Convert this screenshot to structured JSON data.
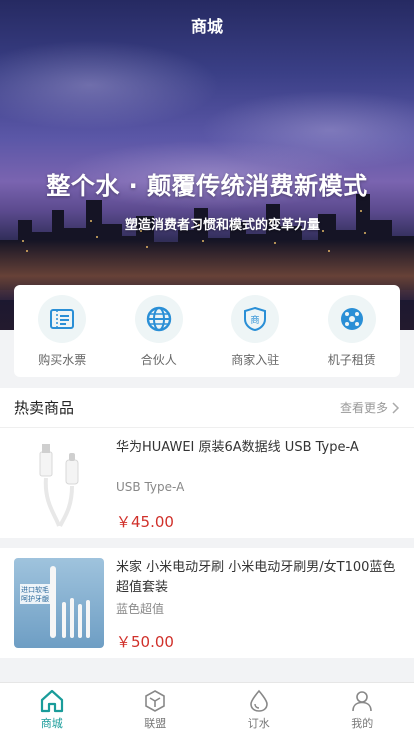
{
  "header": {
    "title": "商城"
  },
  "banner": {
    "headline": "整个水 · 颠覆传统消费新模式",
    "subline": "塑造消费者习惯和模式的变革力量"
  },
  "quick_menu": [
    {
      "label": "购买水票",
      "icon": "ticket-icon"
    },
    {
      "label": "合伙人",
      "icon": "globe-icon"
    },
    {
      "label": "商家入驻",
      "icon": "shop-shield-icon"
    },
    {
      "label": "机子租赁",
      "icon": "machine-rent-icon"
    }
  ],
  "hot": {
    "title": "热卖商品",
    "more_label": "查看更多"
  },
  "products": [
    {
      "name": "华为HUAWEI 原装6A数据线 USB Type-A",
      "spec": "USB Type-A",
      "price": "￥45.00"
    },
    {
      "name": "米家 小米电动牙刷 小米电动牙刷男/女T100蓝色超值套装",
      "spec": "蓝色超值",
      "price": "￥50.00",
      "image_text": [
        "进口软毛",
        "呵护牙龈"
      ]
    }
  ],
  "tabbar": [
    {
      "label": "商城",
      "icon": "home-icon",
      "active": true
    },
    {
      "label": "联盟",
      "icon": "hexagon-icon",
      "active": false
    },
    {
      "label": "订水",
      "icon": "water-drop-icon",
      "active": false
    },
    {
      "label": "我的",
      "icon": "user-icon",
      "active": false
    }
  ],
  "colors": {
    "accent": "#1a9c9a",
    "price": "#d0302a",
    "icon_blue": "#2a8fd6"
  }
}
